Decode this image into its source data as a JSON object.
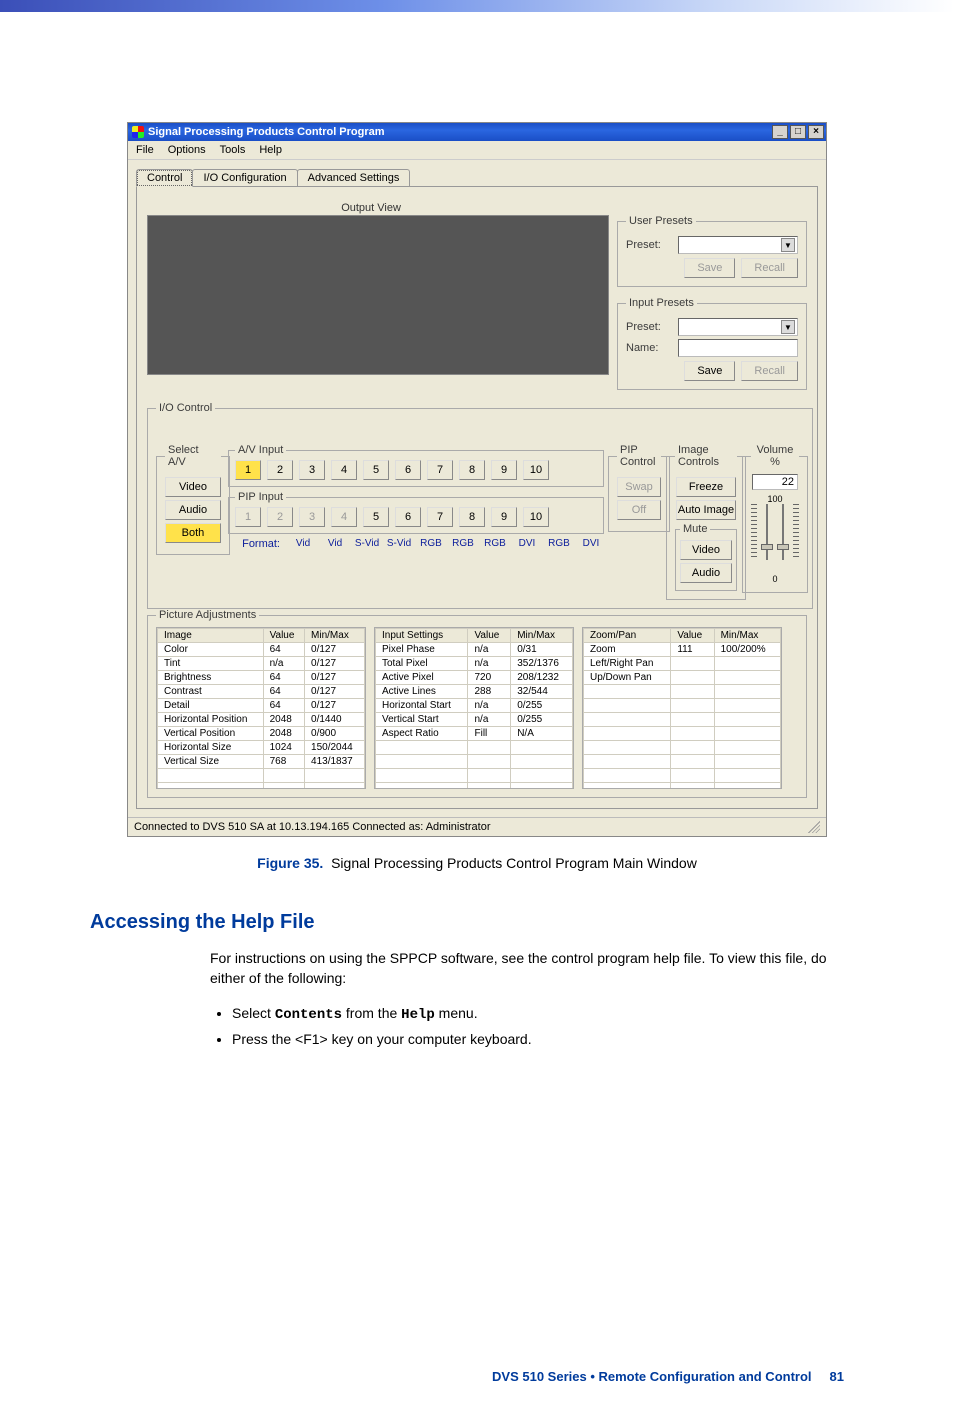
{
  "window": {
    "title": "Signal Processing Products Control Program",
    "menu": [
      "File",
      "Options",
      "Tools",
      "Help"
    ],
    "tabs": [
      "Control",
      "I/O Configuration",
      "Advanced Settings"
    ],
    "status": "Connected to DVS 510 SA at 10.13.194.165   Connected as: Administrator"
  },
  "output_view_label": "Output View",
  "user_presets": {
    "legend": "User Presets",
    "preset_label": "Preset:",
    "save": "Save",
    "recall": "Recall"
  },
  "input_presets": {
    "legend": "Input Presets",
    "preset_label": "Preset:",
    "name_label": "Name:",
    "save": "Save",
    "recall": "Recall"
  },
  "io_control": {
    "legend": "I/O Control",
    "select_av": {
      "legend": "Select A/V",
      "video": "Video",
      "audio": "Audio",
      "both": "Both"
    },
    "av_input_legend": "A/V Input",
    "pip_input_legend": "PIP Input",
    "channels": [
      "1",
      "2",
      "3",
      "4",
      "5",
      "6",
      "7",
      "8",
      "9",
      "10"
    ],
    "format_label": "Format:",
    "formats": [
      "Vid",
      "Vid",
      "S-Vid",
      "S-Vid",
      "RGB",
      "RGB",
      "RGB",
      "DVI",
      "RGB",
      "DVI"
    ]
  },
  "pip_control": {
    "legend": "PIP Control",
    "swap": "Swap",
    "off": "Off"
  },
  "image_controls": {
    "legend": "Image Controls",
    "freeze": "Freeze",
    "auto_image": "Auto Image",
    "mute_legend": "Mute",
    "video": "Video",
    "audio": "Audio"
  },
  "volume": {
    "legend": "Volume %",
    "value": "22",
    "top": "100",
    "bottom": "0"
  },
  "picture_adjustments": {
    "legend": "Picture Adjustments",
    "tables": [
      {
        "headers": [
          "Image",
          "Value",
          "Min/Max"
        ],
        "rows": [
          [
            "Color",
            "64",
            "0/127"
          ],
          [
            "Tint",
            "n/a",
            "0/127"
          ],
          [
            "Brightness",
            "64",
            "0/127"
          ],
          [
            "Contrast",
            "64",
            "0/127"
          ],
          [
            "Detail",
            "64",
            "0/127"
          ],
          [
            "Horizontal Position",
            "2048",
            "0/1440"
          ],
          [
            "Vertical Position",
            "2048",
            "0/900"
          ],
          [
            "Horizontal Size",
            "1024",
            "150/2044"
          ],
          [
            "Vertical Size",
            "768",
            "413/1837"
          ]
        ]
      },
      {
        "headers": [
          "Input Settings",
          "Value",
          "Min/Max"
        ],
        "rows": [
          [
            "Pixel Phase",
            "n/a",
            "0/31"
          ],
          [
            "Total Pixel",
            "n/a",
            "352/1376"
          ],
          [
            "Active Pixel",
            "720",
            "208/1232"
          ],
          [
            "Active Lines",
            "288",
            "32/544"
          ],
          [
            "Horizontal Start",
            "n/a",
            "0/255"
          ],
          [
            "Vertical Start",
            "n/a",
            "0/255"
          ],
          [
            "Aspect Ratio",
            "Fill",
            "N/A"
          ]
        ]
      },
      {
        "headers": [
          "Zoom/Pan",
          "Value",
          "Min/Max"
        ],
        "rows": [
          [
            "Zoom",
            "111",
            "100/200%"
          ],
          [
            "Left/Right Pan",
            "",
            ""
          ],
          [
            "Up/Down Pan",
            "",
            ""
          ]
        ]
      }
    ]
  },
  "caption": {
    "label": "Figure 35.",
    "text": "Signal Processing Products Control Program Main Window"
  },
  "doc": {
    "heading": "Accessing the Help File",
    "para": "For instructions on using the SPPCP software, see the control program help file. To view this file, do either of the following:",
    "li1_pre": "Select ",
    "li1_code1": "Contents",
    "li1_mid": " from the ",
    "li1_code2": "Help",
    "li1_post": " menu.",
    "li2": "Press the <F1> key on your computer keyboard."
  },
  "footer": {
    "text": "DVS 510 Series • Remote Configuration and Control",
    "page": "81"
  }
}
